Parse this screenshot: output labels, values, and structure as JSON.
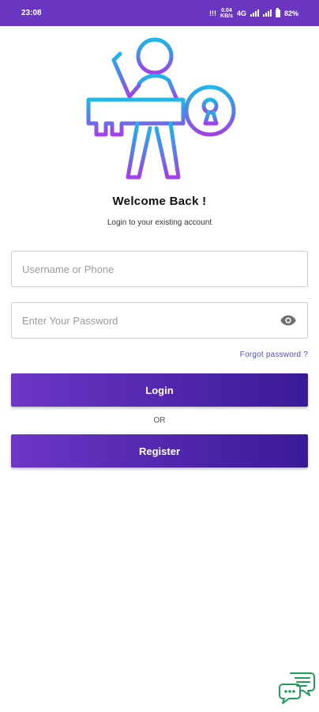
{
  "status_bar": {
    "time": "23:08",
    "indicator_1": "!!!",
    "indicator_2_top": "0.04",
    "indicator_2_bottom": "KB/s",
    "network": "4G",
    "battery": "82%"
  },
  "hero": {
    "icon": "person-with-key-icon"
  },
  "login": {
    "title": "Welcome Back !",
    "subtitle": "Login to your existing account",
    "username_placeholder": "Username or Phone",
    "password_placeholder": "Enter Your Password",
    "forgot_label": "Forgot password ?",
    "login_label": "Login",
    "or_label": "OR",
    "register_label": "Register"
  },
  "colors": {
    "status_bar": "#6a35c1",
    "button_gradient_start": "#6d36c7",
    "button_gradient_end": "#3a1a97",
    "link": "#4a4fb5",
    "chat_icon": "#1e9e5a"
  },
  "chat": {
    "icon": "chat-support-icon"
  }
}
